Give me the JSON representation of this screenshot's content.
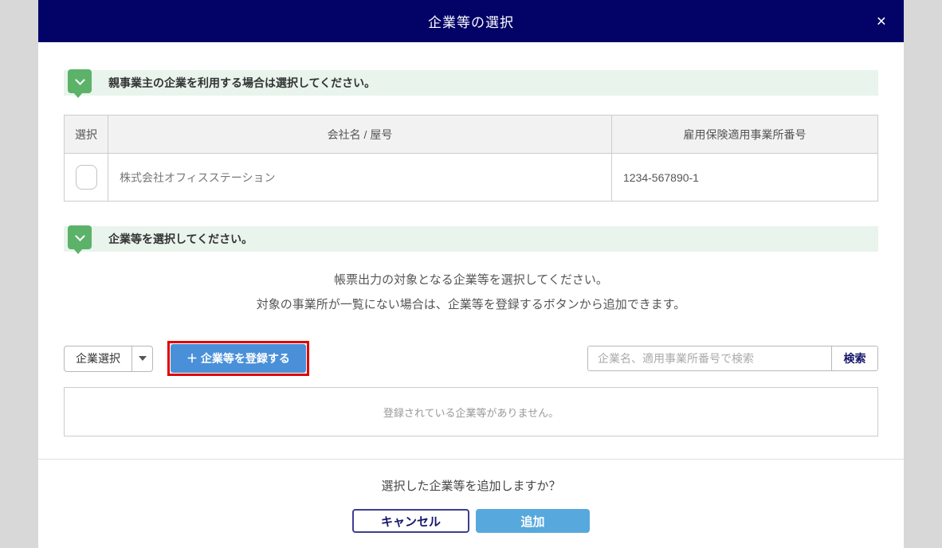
{
  "modal": {
    "title": "企業等の選択",
    "close_icon": "×"
  },
  "section_parent": {
    "label": "親事業主の企業を利用する場合は選択してください。"
  },
  "parent_table": {
    "headers": [
      "選択",
      "会社名 / 屋号",
      "雇用保険適用事業所番号"
    ],
    "rows": [
      {
        "selected": false,
        "company": "株式会社オフィスステーション",
        "insurance_number": "1234-567890-1"
      }
    ]
  },
  "section_select": {
    "label": "企業等を選択してください。"
  },
  "instructions": {
    "line1": "帳票出力の対象となる企業等を選択してください。",
    "line2": "対象の事業所が一覧にない場合は、企業等を登録するボタンから追加できます。"
  },
  "controls": {
    "company_select_label": "企業選択",
    "register_button_label": "＋ 企業等を登録する",
    "search_placeholder": "企業名、適用事業所番号で検索",
    "search_button_label": "検索"
  },
  "empty_list": {
    "message": "登録されている企業等がありません。"
  },
  "footer": {
    "question": "選択した企業等を追加しますか？",
    "cancel_label": "キャンセル",
    "add_label": "追加"
  },
  "colors": {
    "header_navy": "#020267",
    "section_green_bg": "#e9f4ec",
    "badge_green": "#5cb269",
    "register_blue": "#4a90d9",
    "highlight_red": "#e00000",
    "add_blue": "#57a9dd",
    "cancel_border_navy": "#3e3e90"
  }
}
